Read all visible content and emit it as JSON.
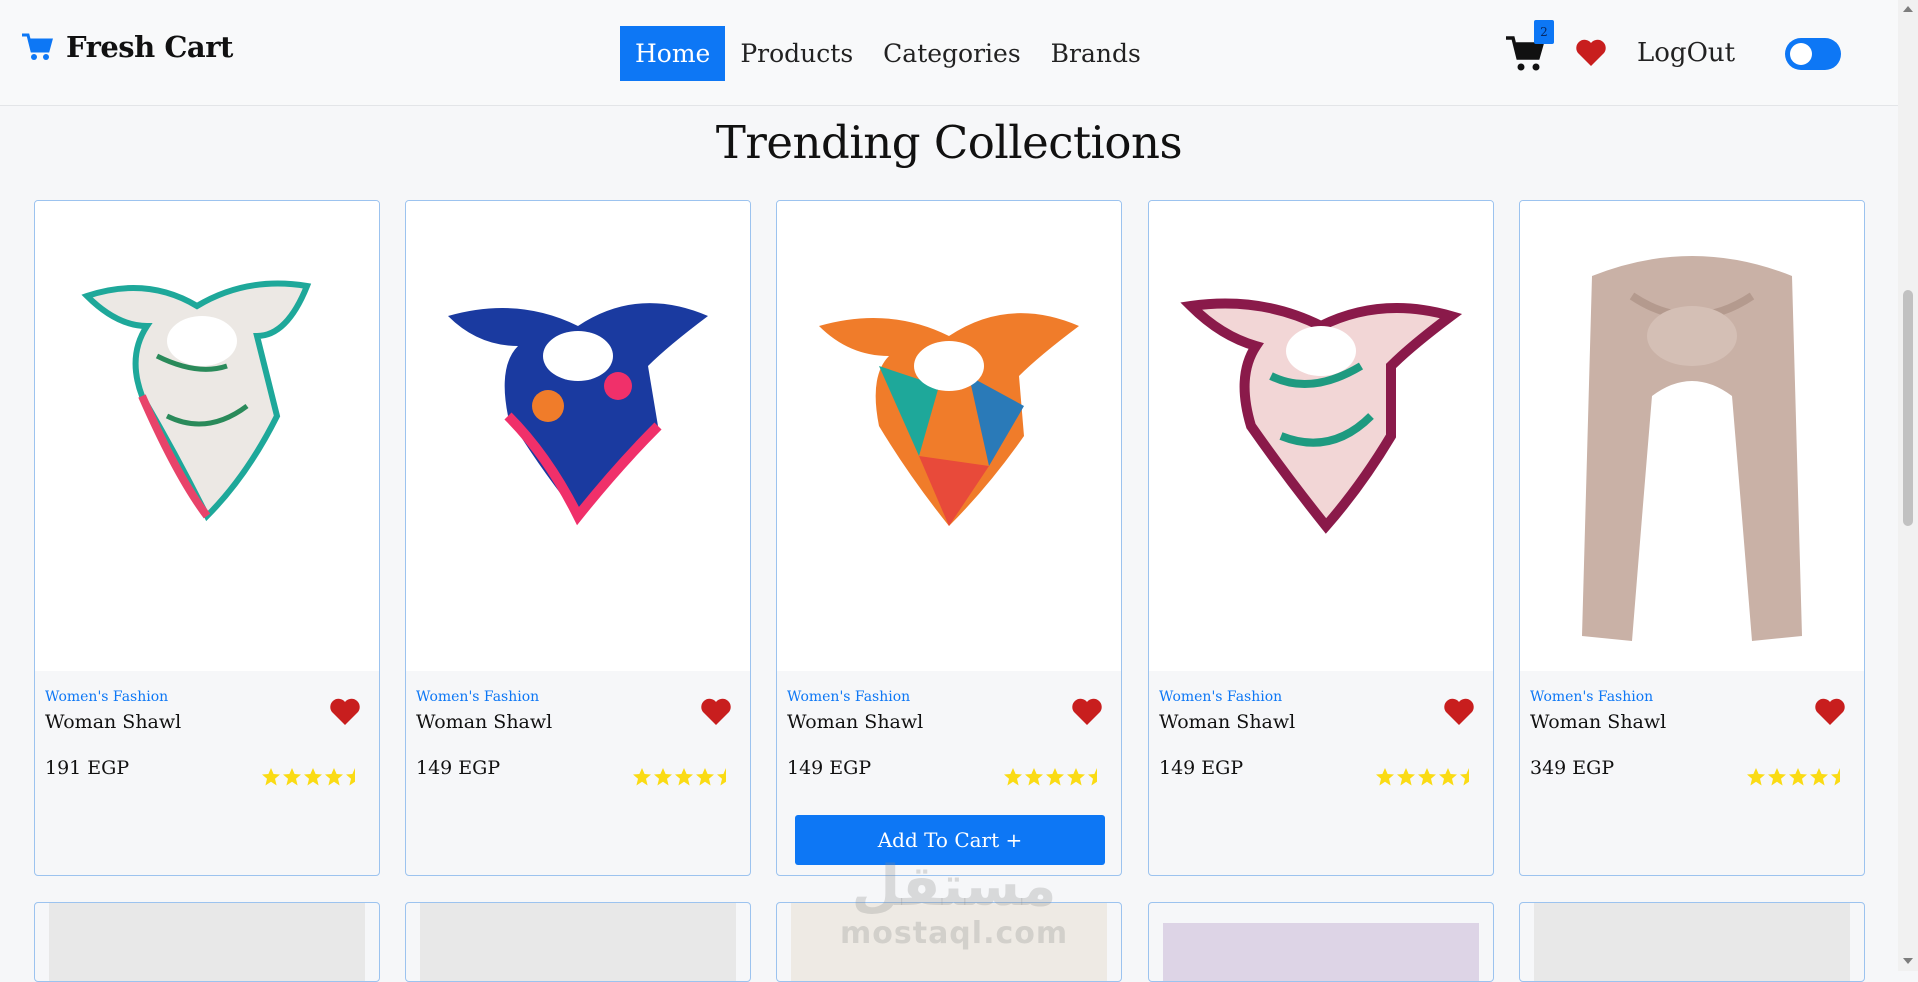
{
  "navbar": {
    "brand": "Fresh Cart",
    "links": [
      "Home",
      "Products",
      "Categories",
      "Brands"
    ],
    "cart_count": "2",
    "logout": "LogOut"
  },
  "section_title": "Trending Collections",
  "products": [
    {
      "category": "Women's Fashion",
      "title": "Woman Shawl",
      "price": "191 EGP",
      "rating": 4.5
    },
    {
      "category": "Women's Fashion",
      "title": "Woman Shawl",
      "price": "149 EGP",
      "rating": 4.5
    },
    {
      "category": "Women's Fashion",
      "title": "Woman Shawl",
      "price": "149 EGP",
      "rating": 4.5,
      "add_to_cart": "Add To Cart +"
    },
    {
      "category": "Women's Fashion",
      "title": "Woman Shawl",
      "price": "149 EGP",
      "rating": 4.5
    },
    {
      "category": "Women's Fashion",
      "title": "Woman Shawl",
      "price": "349 EGP",
      "rating": 4.5
    }
  ],
  "watermark": {
    "arabic": "مستقل",
    "latin": "mostaql.com"
  },
  "colors": {
    "accent": "#0d77f5",
    "heart": "#c81e1e",
    "star": "#fadb14"
  }
}
